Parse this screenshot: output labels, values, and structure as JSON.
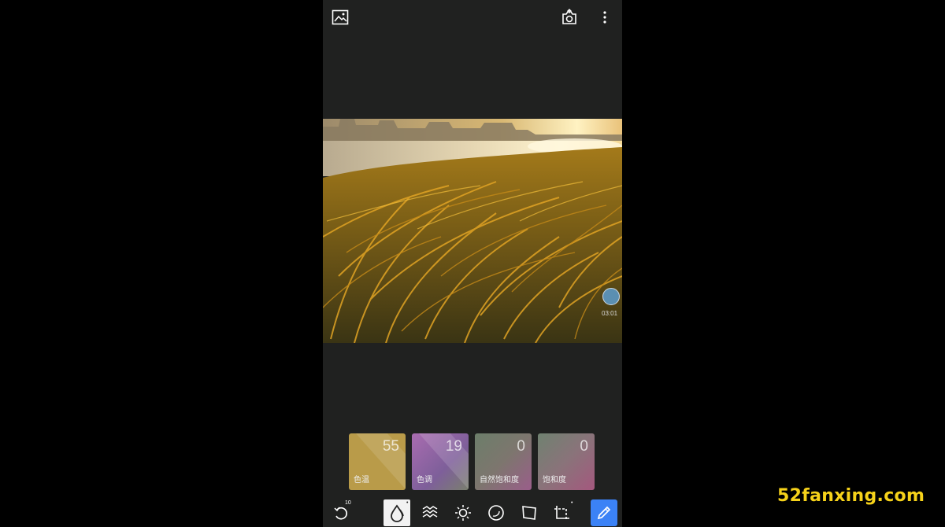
{
  "topbar": {
    "gallery_icon": "image-icon",
    "share_icon": "camera-share-icon",
    "more_icon": "more-vertical-icon"
  },
  "photo": {
    "float_time": "03:01"
  },
  "adjust_cards": [
    {
      "value": "55",
      "label": "色温",
      "color": "#b99b49"
    },
    {
      "value": "19",
      "label": "色调",
      "color": "#9a62a8"
    },
    {
      "value": "0",
      "label": "自然饱和度",
      "color": "#7a7c6a"
    },
    {
      "value": "0",
      "label": "饱和度",
      "color": "#8a6b78"
    }
  ],
  "toolbar": {
    "undo_count": "10",
    "tools": [
      "undo-icon",
      "drop-icon",
      "waves-icon",
      "brightness-icon",
      "vignette-icon",
      "perspective-icon",
      "crop-icon",
      "pen-icon"
    ],
    "pen_color": "#3b82f6"
  },
  "watermark": "52fanxing.com"
}
